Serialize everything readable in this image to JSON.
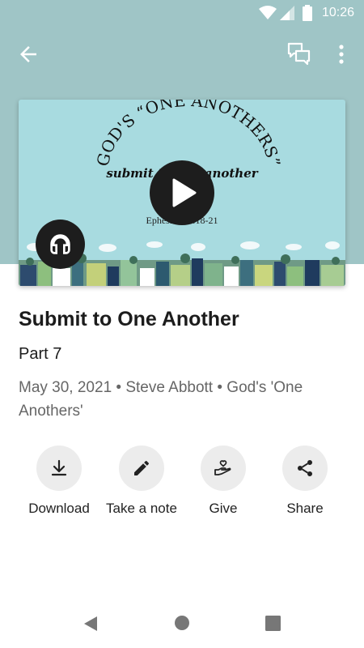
{
  "status_bar": {
    "time": "10:26"
  },
  "artwork": {
    "title_art": "GOD'S “ONE ANOTHERS”",
    "subtitle_art": "submit to one another",
    "part_art": "Part 7",
    "reference_art": "Ephesians 5:18-21"
  },
  "sermon": {
    "title": "Submit to One Another",
    "part": "Part 7",
    "meta": "May 30, 2021 • Steve Abbott • God's 'One Anothers'"
  },
  "actions": {
    "download": "Download",
    "note": "Take a note",
    "give": "Give",
    "share": "Share"
  },
  "icons": {
    "back": "arrow-back-icon",
    "notes": "chat-bubbles-icon",
    "more": "more-vert-icon",
    "play": "play-icon",
    "audio": "headphones-icon"
  },
  "colors": {
    "header_bg": "#9fc5c6",
    "artwork_bg": "#a8dbe0",
    "action_circle": "#ececec"
  }
}
